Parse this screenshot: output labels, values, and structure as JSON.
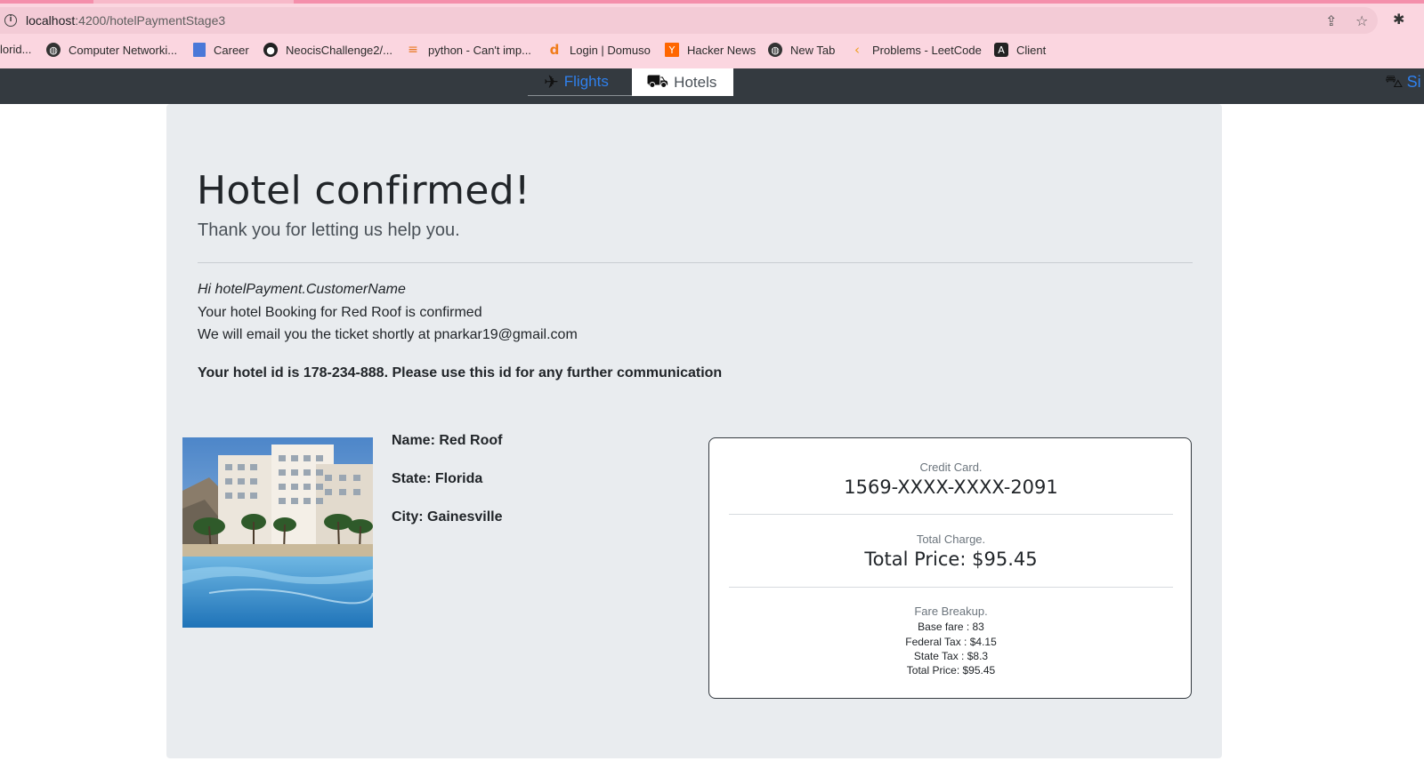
{
  "browser": {
    "url_host": "localhost",
    "url_path": ":4200/hotelPaymentStage3",
    "bookmarks": [
      {
        "label": "lorid...",
        "icon": "none"
      },
      {
        "label": "Computer Networki...",
        "icon": "globe-icon"
      },
      {
        "label": "Career",
        "icon": "bookmark-page-icon"
      },
      {
        "label": "NeocisChallenge2/...",
        "icon": "github-icon"
      },
      {
        "label": "python - Can't imp...",
        "icon": "stackoverflow-icon"
      },
      {
        "label": "Login | Domuso",
        "icon": "domuso-icon"
      },
      {
        "label": "Hacker News",
        "icon": "hackernews-icon"
      },
      {
        "label": "New Tab",
        "icon": "globe-icon"
      },
      {
        "label": "Problems - LeetCode",
        "icon": "leetcode-icon"
      },
      {
        "label": "Client",
        "icon": "angular-icon"
      }
    ]
  },
  "nav": {
    "flights_label": "Flights",
    "hotels_label": "Hotels",
    "right_label": "Si"
  },
  "confirmation": {
    "title": "Hotel confirmed!",
    "subtitle": "Thank you for letting us help you.",
    "greeting": "Hi hotelPayment.CustomerName",
    "booking_line": "Your hotel Booking for Red Roof is confirmed",
    "email_line": "We will email you the ticket shortly at pnarkar19@gmail.com",
    "id_line": "Your hotel id is 178-234-888. Please use this id for any further communication"
  },
  "hotel": {
    "name": "Name: Red Roof",
    "state": "State: Florida",
    "city": "City: Gainesville"
  },
  "payment": {
    "card_label": "Credit Card.",
    "card_number": "1569-XXXX-XXXX-2091",
    "charge_label": "Total Charge.",
    "charge_value": "Total Price: $95.45",
    "breakup_label": "Fare Breakup.",
    "base_fare": "Base fare : 83",
    "federal_tax": "Federal Tax : $4.15",
    "state_tax": "State Tax : $8.3",
    "total": "Total Price: $95.45"
  }
}
